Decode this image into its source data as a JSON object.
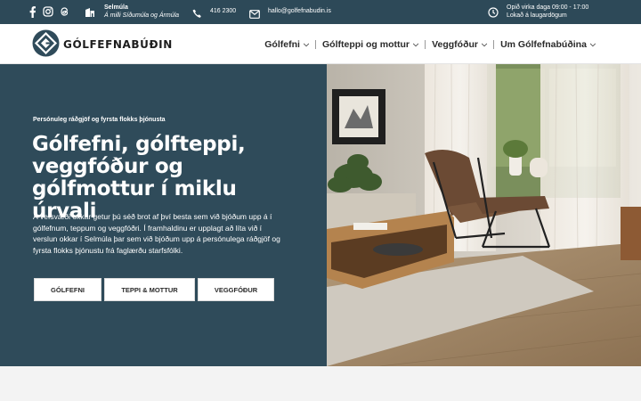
{
  "topbar": {
    "social_icons": [
      "facebook-icon",
      "instagram-icon",
      "threads-icon"
    ],
    "address_line1": "Selmúla",
    "address_line2": "Á milli Síðumúla og Ármúla",
    "phone": "416 2300",
    "email": "hallo@golfefnabudin.is",
    "hours_line1": "Opið virka daga 09:00 - 17:00",
    "hours_line2": "Lokað á laugardögum"
  },
  "header": {
    "logo_text": "GÓLFEFNABÚÐIN",
    "nav": [
      "Gólfefni",
      "Gólfteppi og mottur",
      "Veggfóður",
      "Um Gólfefnabúðina"
    ]
  },
  "hero": {
    "eyebrow": "Persónuleg ráðgjöf og fyrsta flokks þjónusta",
    "title": "Gólfefni, gólfteppi, veggfóður og gólfmottur í miklu úrvali",
    "body": "Á vefsvæði okkar getur þú séð brot af því besta sem við bjóðum upp á í gólfefnum, teppum og veggfóðri. Í framhaldinu er upplagt að líta við í verslun okkar í Selmúla þar sem við bjóðum upp á persónulega ráðgjöf og fyrsta flokks þjónustu frá faglærðu starfsfólki.",
    "buttons": [
      "GÓLFEFNI",
      "TEPPI & MOTTUR",
      "VEGGFÓÐUR"
    ]
  },
  "colors": {
    "topbar_bg": "#2d4958",
    "hero_bg": "#2f4b5a",
    "accent_text": "#ffffff"
  }
}
